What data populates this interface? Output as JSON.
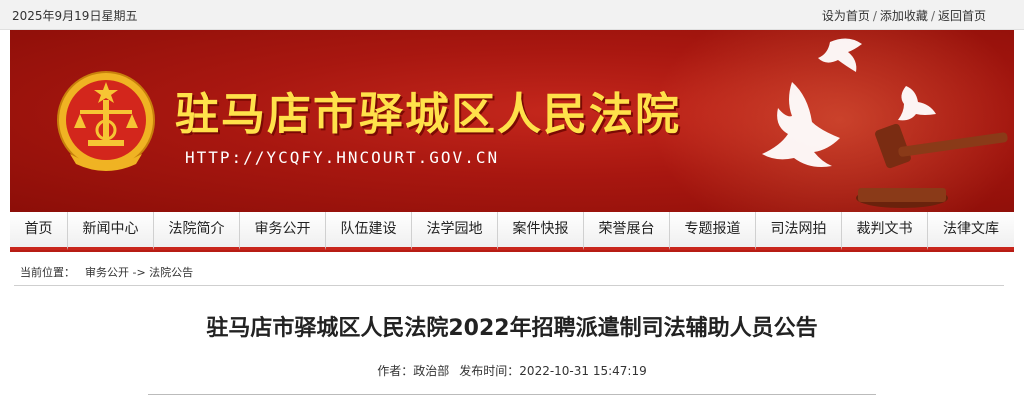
{
  "topbar": {
    "date": "2025年9月19日星期五",
    "links": [
      "设为首页",
      "添加收藏",
      "返回首页"
    ],
    "separator": "/"
  },
  "banner": {
    "title": "驻马店市驿城区人民法院",
    "url": "HTTP://YCQFY.HNCOURT.GOV.CN",
    "emblem_icon": "court-emblem-icon",
    "decoration_icons": [
      "dove-icon",
      "gavel-icon"
    ]
  },
  "nav": {
    "items": [
      "首页",
      "新闻中心",
      "法院简介",
      "审务公开",
      "队伍建设",
      "法学园地",
      "案件快报",
      "荣誉展台",
      "专题报道",
      "司法网拍",
      "裁判文书",
      "法律文库"
    ]
  },
  "breadcrumb": {
    "label": "当前位置：",
    "path": "审务公开 -> 法院公告"
  },
  "article": {
    "title": "驻马店市驿城区人民法院2022年招聘派遣制司法辅助人员公告",
    "author_label": "作者：",
    "author": "政治部",
    "date_label": "发布时间：",
    "date": "2022-10-31 15:47:19"
  },
  "colors": {
    "brand_red": "#b71c14",
    "title_yellow": "#ffe14a"
  }
}
